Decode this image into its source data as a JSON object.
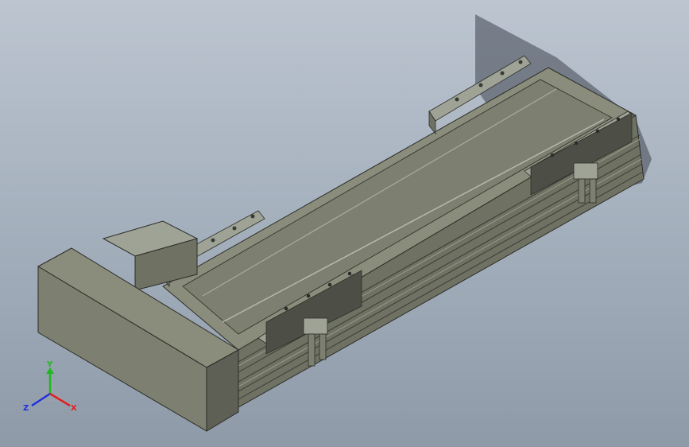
{
  "viewport": {
    "background_top": "#bcc5d0",
    "background_bottom": "#8e9aa8"
  },
  "model": {
    "body_color": "#8a8c7c",
    "frame_color": "#6f7163",
    "rail_color": "#9fa396",
    "block_color": "#5e6055",
    "edge_color": "#2c2d28",
    "shadow_color": "#3f4650"
  },
  "triad": {
    "x_label": "X",
    "y_label": "Y",
    "z_label": "Z",
    "x_color": "#e02020",
    "y_color": "#1fb81f",
    "z_color": "#2030e0"
  }
}
